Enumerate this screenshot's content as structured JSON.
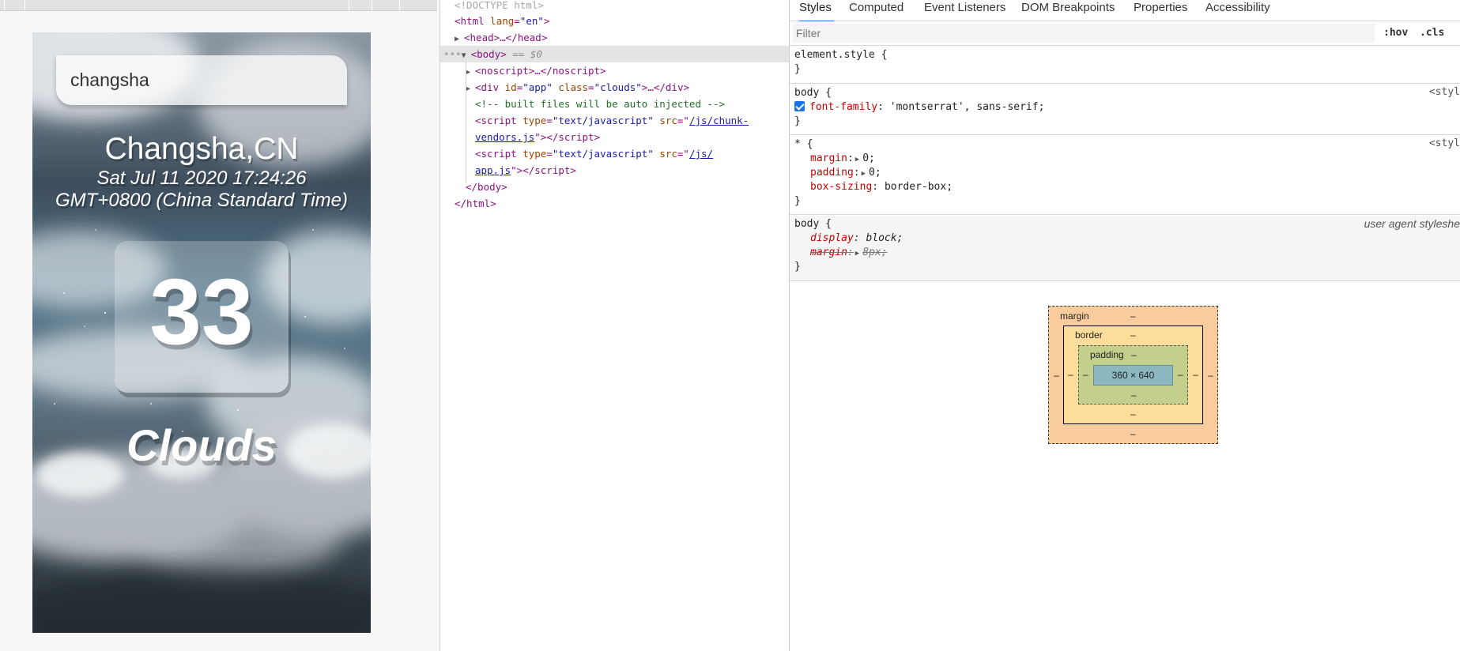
{
  "weather_app": {
    "search_value": "changsha",
    "location": "Changsha,CN",
    "date_line1": "Sat Jul 11 2020 17:24:26",
    "date_line2": "GMT+0800 (China Standard Time)",
    "temperature": "33",
    "condition": "Clouds"
  },
  "elements": {
    "doctype": "<!DOCTYPE html>",
    "html_open_tag": "html",
    "html_lang_attr": "lang",
    "html_lang_val": "\"en\"",
    "head": "<head>…</head>",
    "body_tag": "<body>",
    "body_suffix": "== $0",
    "noscript": "<noscript>…</noscript>",
    "div_tag": "div",
    "div_id_attr": "id",
    "div_id_val": "\"app\"",
    "div_class_attr": "class",
    "div_class_val": "\"clouds\"",
    "div_tail": ">…</div>",
    "comment": "<!-- built files will be auto injected -->",
    "script1_src_1": "/js/chunk-",
    "script1_src_2": "vendors.js",
    "script2_src_1": "/js/",
    "script2_src_2": "app.js",
    "script_type_attr": "type",
    "script_type_val": "\"text/javascript\"",
    "script_src_attr": "src",
    "body_close": "</body>",
    "html_close": "</html>"
  },
  "styles": {
    "tabs": [
      "Styles",
      "Computed",
      "Event Listeners",
      "DOM Breakpoints",
      "Properties",
      "Accessibility"
    ],
    "filter_placeholder": "Filter",
    "hov": ":hov",
    "cls": ".cls",
    "element_style": "element.style {",
    "rule1_selector": "body {",
    "rule1_prop": "font-family",
    "rule1_value": "'montserrat', sans-serif;",
    "rule1_origin": "<styl",
    "rule2_selector": "* {",
    "rule2_origin": "<styl",
    "rule2_margin": "margin",
    "rule2_margin_val": "0;",
    "rule2_padding": "padding",
    "rule2_padding_val": "0;",
    "rule2_boxsizing": "box-sizing",
    "rule2_boxsizing_val": "border-box;",
    "rule3_selector": "body {",
    "rule3_origin": "user agent styleshe",
    "rule3_display": "display",
    "rule3_display_val": "block;",
    "rule3_margin": "margin",
    "rule3_margin_val": "8px;",
    "close_brace": "}"
  },
  "box_model": {
    "margin_label": "margin",
    "border_label": "border",
    "padding_label": "padding",
    "content_size": "360 × 640",
    "dash": "–"
  },
  "colors": {
    "accent": "#1a73e8",
    "tag": "#881280",
    "attribute": "#994500",
    "property": "#c80000"
  }
}
